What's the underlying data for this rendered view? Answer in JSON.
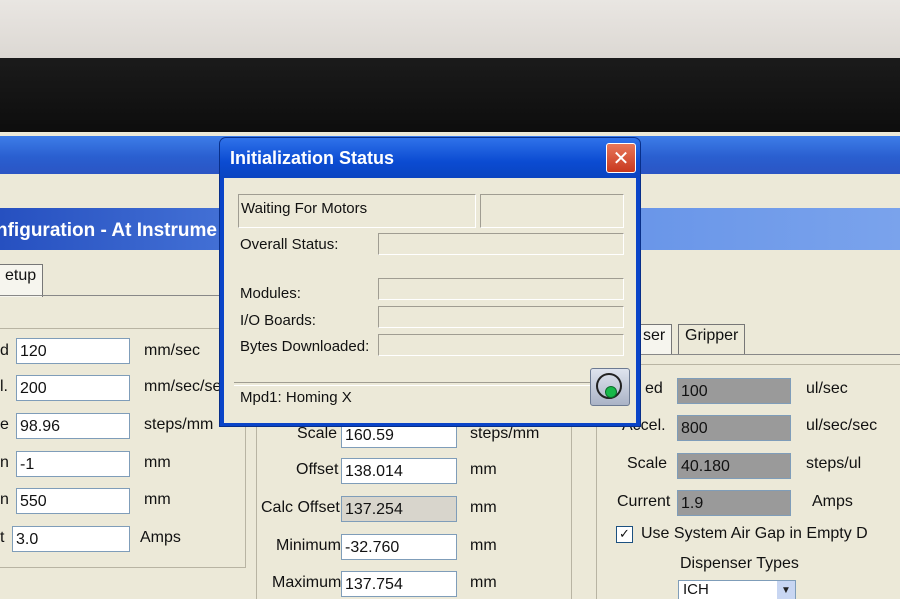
{
  "dialog": {
    "title": "Initialization Status",
    "close_label": "✕",
    "waiting_text": "Waiting For Motors",
    "overall_status_label": "Overall Status:",
    "modules_label": "Modules:",
    "io_boards_label": "I/O Boards:",
    "bytes_downloaded_label": "Bytes Downloaded:",
    "status_message": "Mpd1: Homing X",
    "busy_icon": "busy-spinner-icon"
  },
  "background_window": {
    "header_title": "nfiguration - At Instrume",
    "setup_tab": "etup",
    "left_panel": {
      "rows": [
        {
          "label": "d",
          "value": "120",
          "unit": "mm/sec"
        },
        {
          "label": "l.",
          "value": "200",
          "unit": "mm/sec/se"
        },
        {
          "label": "e",
          "value": "98.96",
          "unit": "steps/mm"
        },
        {
          "label": "n",
          "value": "-1",
          "unit": "mm"
        },
        {
          "label": "n",
          "value": "550",
          "unit": "mm"
        },
        {
          "label": "t",
          "value": "3.0",
          "unit": "Amps"
        }
      ]
    },
    "middle_panel": {
      "rows": [
        {
          "label": "Scale",
          "value": "160.59",
          "unit": "steps/mm"
        },
        {
          "label": "Offset",
          "value": "138.014",
          "unit": "mm"
        },
        {
          "label": "Calc Offset",
          "value": "137.254",
          "unit": "mm"
        },
        {
          "label": "Minimum",
          "value": "-32.760",
          "unit": "mm"
        },
        {
          "label": "Maximum",
          "value": "137.754",
          "unit": "mm"
        }
      ]
    },
    "right_panel": {
      "tabs": [
        "ser",
        "Gripper"
      ],
      "rows": [
        {
          "label": "ed",
          "value": "100",
          "unit": "ul/sec"
        },
        {
          "label": "Accel.",
          "value": "800",
          "unit": "ul/sec/sec"
        },
        {
          "label": "Scale",
          "value": "40.180",
          "unit": "steps/ul"
        },
        {
          "label": "Current",
          "value": "1.9",
          "unit": "Amps"
        }
      ],
      "air_gap_checkbox_label": "Use System Air Gap in Empty D",
      "air_gap_checked": true,
      "dispenser_types_label": "Dispenser Types",
      "dispenser_type_value": "ICH"
    }
  }
}
